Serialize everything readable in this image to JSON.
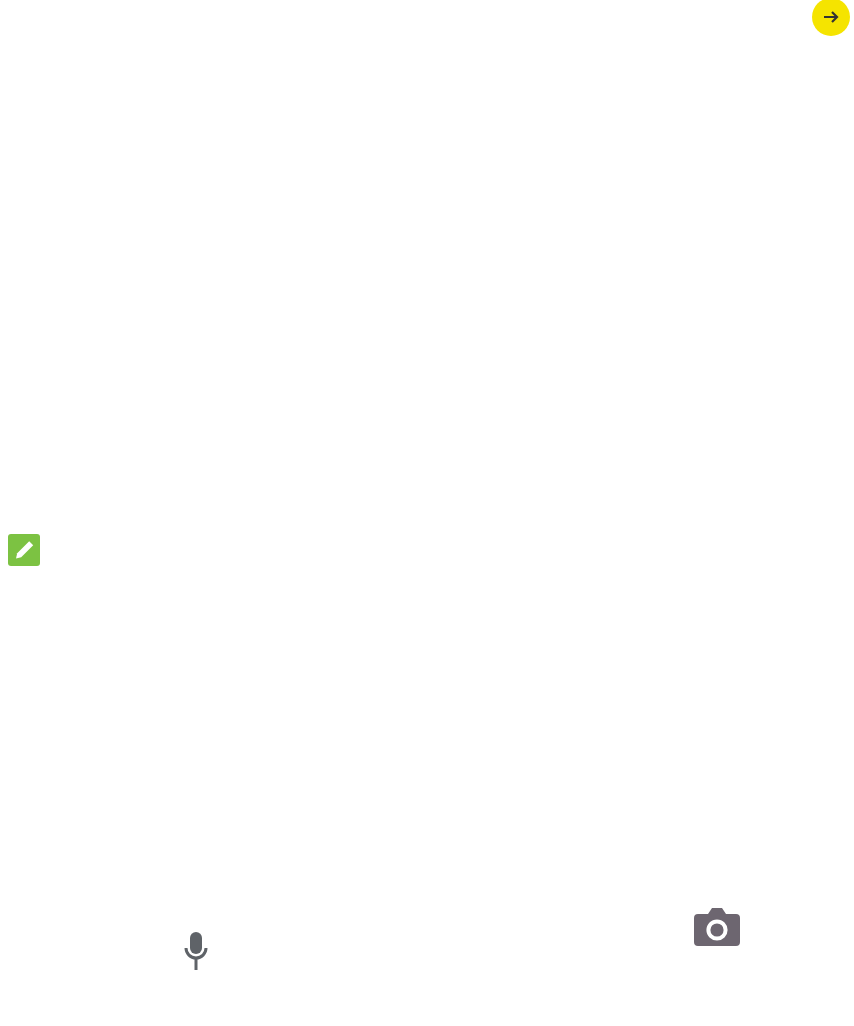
{
  "icons": [
    {
      "kind": "arrow"
    },
    {
      "kind": "pencil"
    },
    {
      "kind": "camera"
    },
    {
      "kind": "mic"
    }
  ]
}
